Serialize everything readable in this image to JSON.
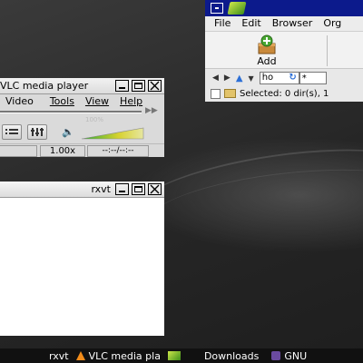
{
  "file_manager": {
    "menu": [
      "File",
      "Edit",
      "Browser",
      "Org"
    ],
    "add_label": "Add",
    "path_value": "ho",
    "filter_value": "*",
    "status_text": "Selected: 0 dir(s), 1"
  },
  "vlc": {
    "title": "VLC media player",
    "menu": [
      "Video",
      "Tools",
      "View",
      "Help"
    ],
    "volume_label": "100%",
    "speed": "1.00x",
    "time": "--:--/--:--"
  },
  "rxvt": {
    "title": "rxvt"
  },
  "taskbar": {
    "items": [
      "rxvt",
      "VLC media pla",
      "Downloads",
      "GNU"
    ]
  }
}
